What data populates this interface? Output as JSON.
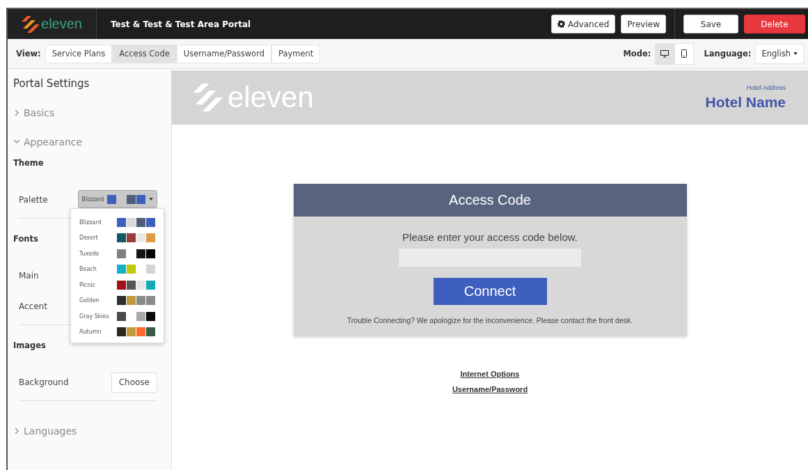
{
  "header": {
    "logo": "eleven",
    "title": "Test & Test & Test Area Portal",
    "buttons": [
      {
        "label": "Advanced",
        "kind": "gear"
      },
      {
        "label": "Preview",
        "kind": "plain"
      },
      {
        "label": "Save",
        "kind": "plain"
      },
      {
        "label": "Delete",
        "kind": "danger"
      }
    ]
  },
  "view_bar": {
    "label": "View:",
    "tabs": [
      {
        "label": "Service Plans",
        "selected": false
      },
      {
        "label": "Access Code",
        "selected": true
      },
      {
        "label": "Username/Password",
        "selected": false
      },
      {
        "label": "Payment",
        "selected": false
      }
    ],
    "mode": {
      "label": "Mode:",
      "buttons": [
        {
          "kind": "desktop",
          "selected": true
        },
        {
          "kind": "mobile",
          "selected": false
        }
      ]
    },
    "language": {
      "label": "Language:",
      "value": "English"
    }
  },
  "sidebar": {
    "title": "Portal Settings",
    "sections": [
      {
        "label": "Basics",
        "expanded": false
      },
      {
        "label": "Appearance",
        "expanded": true,
        "groups": [
          {
            "heading": "Theme",
            "rows": [
              {
                "label": "Palette",
                "kind": "palette",
                "value": "Blizzard",
                "swatches": [
                  {
                    "kind": "color",
                    "color": "#3f5fbf"
                  },
                  {
                    "kind": "blank"
                  },
                  {
                    "kind": "color",
                    "color": "#4f5d7a"
                  },
                  {
                    "kind": "color",
                    "color": "#3f5fbf"
                  }
                ]
              }
            ]
          },
          {
            "heading": "Fonts",
            "rows": [
              {
                "label": "Main",
                "kind": "plain"
              },
              {
                "label": "Accent",
                "kind": "plain"
              }
            ]
          },
          {
            "heading": "Images",
            "rows": [
              {
                "label": "Background",
                "kind": "button",
                "button": "Choose"
              }
            ]
          }
        ]
      },
      {
        "label": "Languages",
        "expanded": false
      }
    ]
  },
  "palette_menu": [
    {
      "name": "Blizzard",
      "swatches": [
        {
          "kind": "color",
          "color": "#3f5fbf"
        },
        {
          "kind": "color",
          "color": "#d9d9d9"
        },
        {
          "kind": "color",
          "color": "#4f5d7a"
        },
        {
          "kind": "color",
          "color": "#3f5fbf"
        }
      ]
    },
    {
      "name": "Desert",
      "swatches": [
        {
          "kind": "color",
          "color": "#0f5a66"
        },
        {
          "kind": "color",
          "color": "#9a3c3a"
        },
        {
          "kind": "color",
          "color": "#e8e8e8"
        },
        {
          "kind": "color",
          "color": "#e09a45"
        }
      ]
    },
    {
      "name": "Tuxedo",
      "swatches": [
        {
          "kind": "color",
          "color": "#808080"
        },
        {
          "kind": "blank"
        },
        {
          "kind": "color",
          "color": "#151515"
        },
        {
          "kind": "color",
          "color": "#050505"
        }
      ]
    },
    {
      "name": "Beach",
      "swatches": [
        {
          "kind": "color",
          "color": "#14b0c8"
        },
        {
          "kind": "color",
          "color": "#c3c80a"
        },
        {
          "kind": "blank"
        },
        {
          "kind": "color",
          "color": "#d4d4d4"
        }
      ]
    },
    {
      "name": "Picnic",
      "swatches": [
        {
          "kind": "color",
          "color": "#a30f14"
        },
        {
          "kind": "color",
          "color": "#555555"
        },
        {
          "kind": "color",
          "color": "#e6e6e6"
        },
        {
          "kind": "color",
          "color": "#16aab5"
        }
      ]
    },
    {
      "name": "Golden",
      "swatches": [
        {
          "kind": "color",
          "color": "#2e2e2e"
        },
        {
          "kind": "color",
          "color": "#c29a3e"
        },
        {
          "kind": "color",
          "color": "#8a8a8a"
        },
        {
          "kind": "color",
          "color": "#8a8a8a"
        }
      ]
    },
    {
      "name": "Gray Skies",
      "swatches": [
        {
          "kind": "color",
          "color": "#4a4a4a"
        },
        {
          "kind": "blank"
        },
        {
          "kind": "color",
          "color": "#a8a8a8"
        },
        {
          "kind": "color",
          "color": "#080808"
        }
      ]
    },
    {
      "name": "Autumn",
      "swatches": [
        {
          "kind": "color",
          "color": "#2e2620"
        },
        {
          "kind": "color",
          "color": "#c29a3e"
        },
        {
          "kind": "color",
          "color": "#ff6a2a"
        },
        {
          "kind": "color",
          "color": "#3a5a48"
        }
      ]
    }
  ],
  "preview": {
    "logo": "eleven",
    "hotel_address": "Hotel Address",
    "hotel_name": "Hotel Name",
    "card": {
      "title": "Access Code",
      "prompt": "Please enter your access code below.",
      "button": "Connect",
      "help": "Trouble Connecting? We apologize for the inconvenience. Please contact the front desk."
    },
    "links": [
      "Internet Options",
      "Username/Password"
    ]
  }
}
